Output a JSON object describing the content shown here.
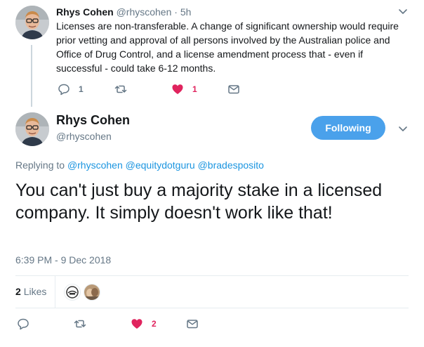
{
  "colors": {
    "accent": "#4aa1eb",
    "link": "#1b95e0",
    "like": "#e0245e",
    "muted": "#657786"
  },
  "parent_tweet": {
    "name": "Rhys Cohen",
    "handle": "@rhyscohen",
    "separator": "·",
    "time": "5h",
    "text": "Licenses are non-transferable. A change of significant ownership would require prior vetting and approval of all persons involved by the Australian police and Office of Drug Control, and a license amendment process that - even if successful - could take 6-12 months.",
    "reply_count": "1",
    "retweet_count": "",
    "like_count": "1",
    "liked": true
  },
  "main_tweet": {
    "name": "Rhys Cohen",
    "handle": "@rhyscohen",
    "follow_label": "Following",
    "replying_prefix": "Replying to",
    "mentions": [
      "@rhyscohen",
      "@equitydotguru",
      "@bradesposito"
    ],
    "text": "You can't just buy a majority stake in a licensed company. It simply doesn't work like that!",
    "timestamp": "6:39 PM - 9 Dec 2018",
    "likes_count": "2",
    "likes_label": "Likes",
    "like_count": "2",
    "liked": true
  },
  "icons": {
    "reply": "reply-icon",
    "retweet": "retweet-icon",
    "like": "heart-icon",
    "dm": "envelope-icon",
    "more": "chevron-down-icon"
  }
}
